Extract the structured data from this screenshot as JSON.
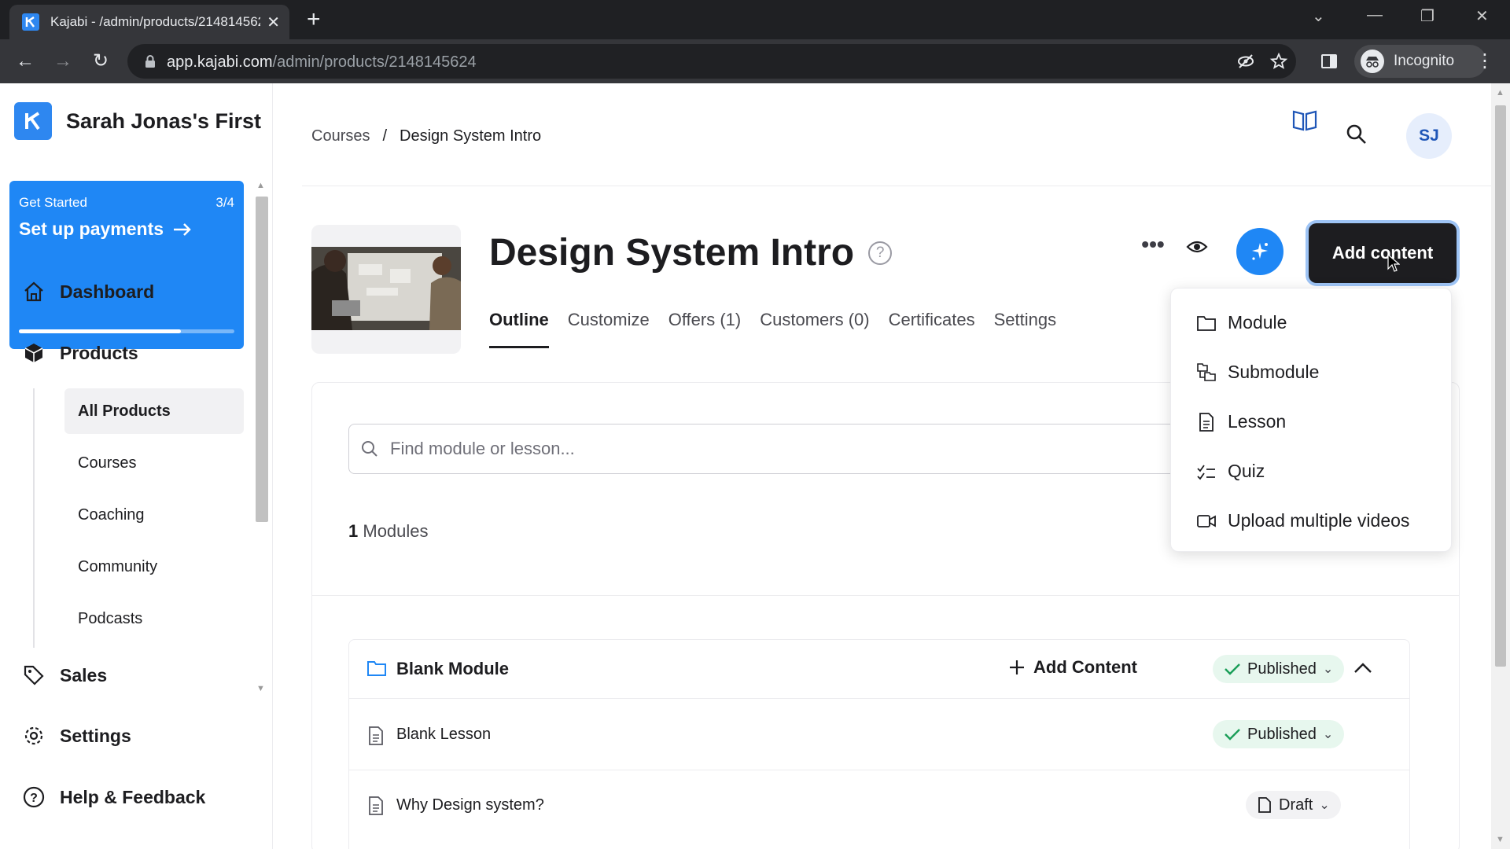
{
  "browser": {
    "tab_title": "Kajabi - /admin/products/2148145624",
    "url_host": "app.kajabi.com",
    "url_path": "/admin/products/2148145624",
    "profile_label": "Incognito"
  },
  "sidebar": {
    "site_name": "Sarah Jonas's First",
    "promo": {
      "eyebrow": "Get Started",
      "progress_text": "3/4",
      "progress_fraction": 0.75,
      "title": "Set up payments"
    },
    "nav": [
      {
        "label": "Dashboard",
        "icon": "home-icon"
      },
      {
        "label": "Products",
        "icon": "box-icon"
      },
      {
        "label": "Sales",
        "icon": "tag-icon"
      },
      {
        "label": "Settings",
        "icon": "gear-icon"
      },
      {
        "label": "Help & Feedback",
        "icon": "help-icon"
      }
    ],
    "sub_items": [
      {
        "label": "All Products",
        "active": true
      },
      {
        "label": "Courses",
        "active": false
      },
      {
        "label": "Coaching",
        "active": false
      },
      {
        "label": "Community",
        "active": false
      },
      {
        "label": "Podcasts",
        "active": false
      }
    ]
  },
  "header": {
    "breadcrumb": [
      "Courses",
      "Design System Intro"
    ],
    "breadcrumb_sep": "/",
    "avatar_initials": "SJ"
  },
  "product": {
    "title": "Design System Intro",
    "help_glyph": "?",
    "tabs": [
      "Outline",
      "Customize",
      "Offers (1)",
      "Customers (0)",
      "Certificates",
      "Settings"
    ],
    "active_tab": "Outline",
    "more_label": "•••",
    "add_button": "Add content"
  },
  "outline": {
    "search_placeholder": "Find module or lesson...",
    "module_count_number": "1",
    "module_count_label": "Modules",
    "module": {
      "name": "Blank Module",
      "add_label": "Add Content",
      "status": "Published",
      "lessons": [
        {
          "name": "Blank Lesson",
          "status": "Published"
        },
        {
          "name": "Why Design system?",
          "status": "Draft"
        }
      ]
    }
  },
  "dropdown": {
    "items": [
      {
        "label": "Module",
        "icon": "folder-icon"
      },
      {
        "label": "Submodule",
        "icon": "submodule-icon"
      },
      {
        "label": "Lesson",
        "icon": "document-icon"
      },
      {
        "label": "Quiz",
        "icon": "quiz-icon"
      },
      {
        "label": "Upload multiple videos",
        "icon": "video-icon"
      }
    ]
  },
  "colors": {
    "brand": "#1f87f5",
    "dark": "#1d1d20",
    "published_bg": "#e7f7ee",
    "published_check": "#1a9e58"
  }
}
